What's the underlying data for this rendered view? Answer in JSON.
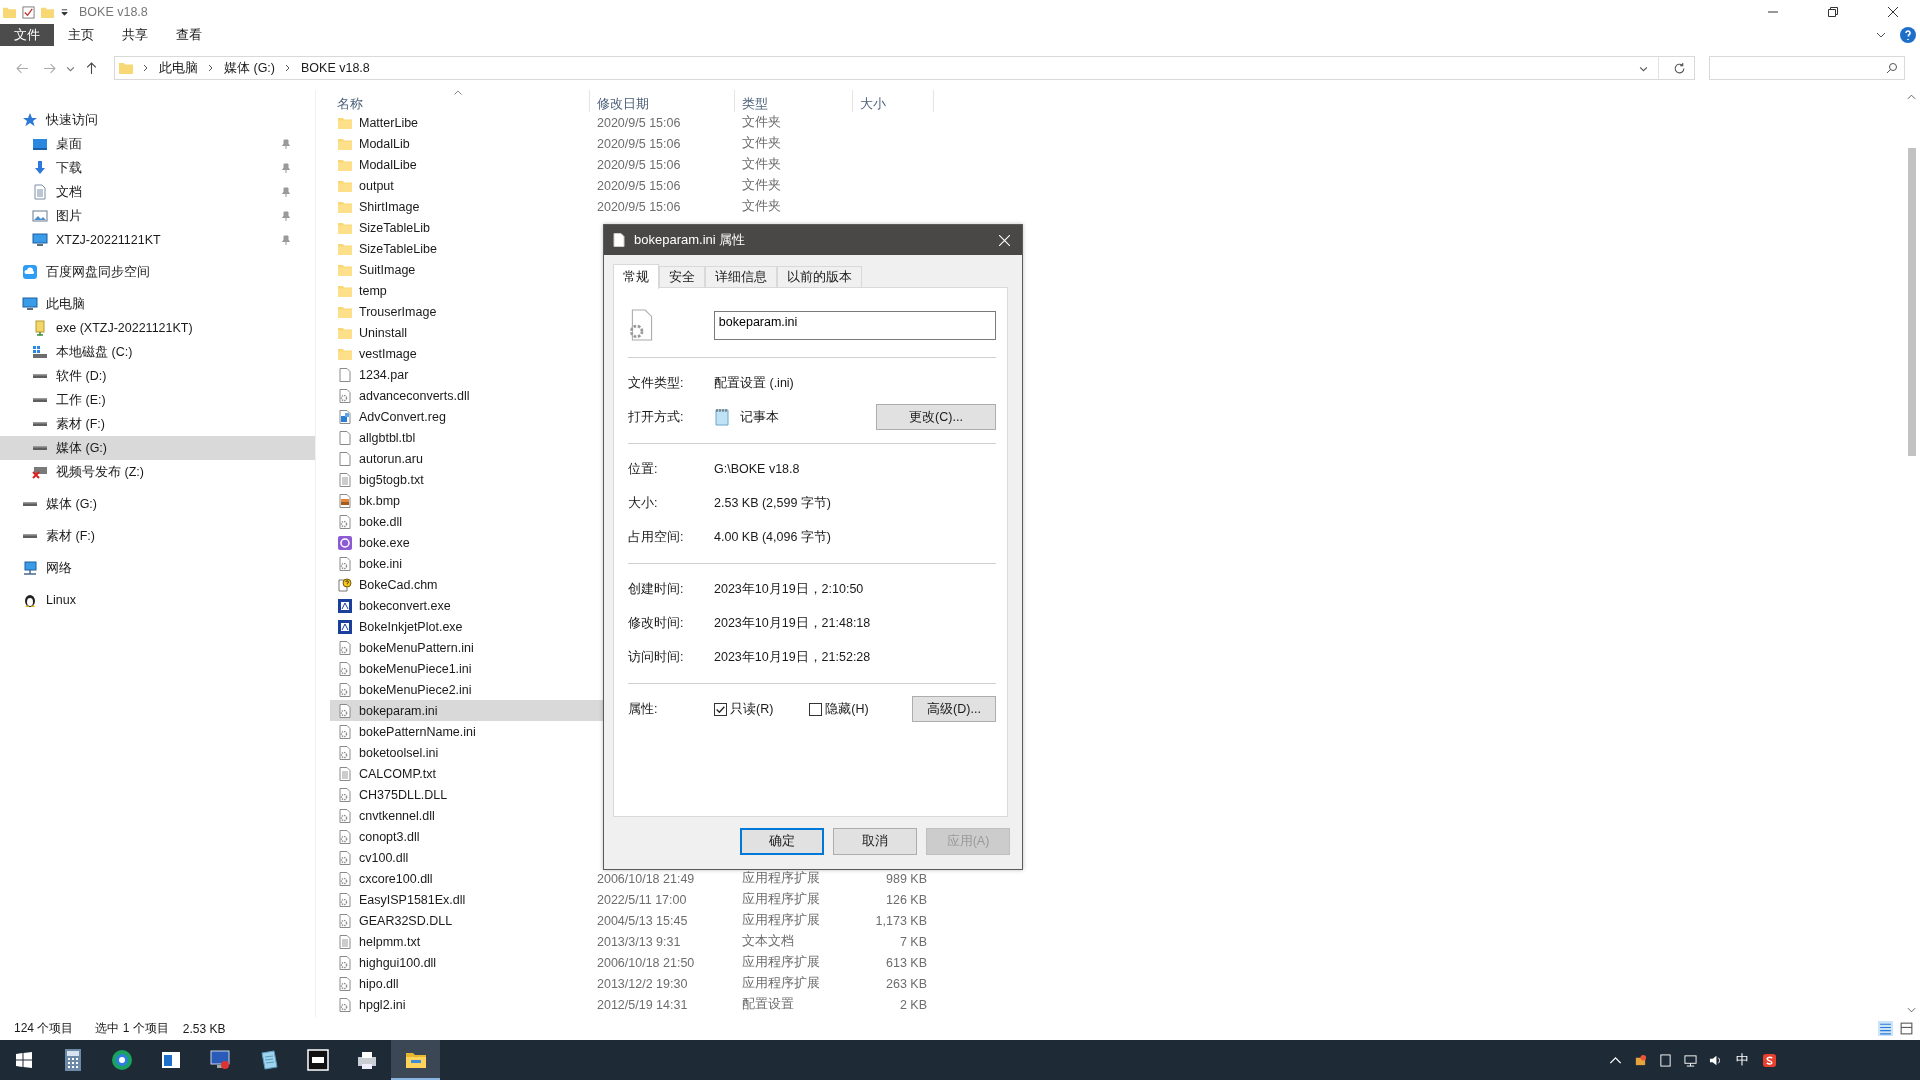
{
  "window": {
    "title": "BOKE v18.8"
  },
  "ribbon_tabs": [
    {
      "label": "文件",
      "selected": true
    },
    {
      "label": "主页",
      "selected": false
    },
    {
      "label": "共享",
      "selected": false
    },
    {
      "label": "查看",
      "selected": false
    }
  ],
  "address_bar": {
    "path": [
      "此电脑",
      "媒体 (G:)",
      "BOKE v18.8"
    ]
  },
  "nav": [
    {
      "label": "快速访问",
      "kind": "star",
      "selected": false,
      "children": [
        {
          "label": "桌面",
          "kind": "desktop",
          "selected": false,
          "pinned": true
        },
        {
          "label": "下载",
          "kind": "download",
          "selected": false,
          "pinned": true
        },
        {
          "label": "文档",
          "kind": "document",
          "selected": false,
          "pinned": true
        },
        {
          "label": "图片",
          "kind": "pictures",
          "selected": false,
          "pinned": true
        },
        {
          "label": "XTZJ-20221121KT",
          "kind": "computer",
          "selected": false,
          "pinned": true
        }
      ]
    },
    {
      "label": "百度网盘同步空间",
      "kind": "cloud",
      "selected": false
    },
    {
      "label": "此电脑",
      "kind": "computer",
      "selected": false,
      "children": [
        {
          "label": "exe (XTZJ-20221121KT)",
          "kind": "usb",
          "selected": false
        },
        {
          "label": "本地磁盘 (C:)",
          "kind": "system",
          "selected": false
        },
        {
          "label": "软件 (D:)",
          "kind": "drive",
          "selected": false
        },
        {
          "label": "工作 (E:)",
          "kind": "drive",
          "selected": false
        },
        {
          "label": "素材 (F:)",
          "kind": "drive",
          "selected": false
        },
        {
          "label": "媒体 (G:)",
          "kind": "drive",
          "selected": true
        },
        {
          "label": "视频号发布 (Z:)",
          "kind": "netdrive",
          "selected": false
        }
      ]
    },
    {
      "label": "媒体 (G:)",
      "kind": "drive",
      "selected": false
    },
    {
      "label": "素材 (F:)",
      "kind": "drive",
      "selected": false
    },
    {
      "label": "网络",
      "kind": "network",
      "selected": false
    },
    {
      "label": "Linux",
      "kind": "penguin",
      "selected": false
    }
  ],
  "columns": [
    "名称",
    "修改日期",
    "类型",
    "大小"
  ],
  "files": [
    {
      "name": "MatterLibe",
      "kind": "folder",
      "date": "2020/9/5 15:06",
      "type": "文件夹",
      "selected": false
    },
    {
      "name": "ModalLib",
      "kind": "folder",
      "date": "2020/9/5 15:06",
      "type": "文件夹",
      "selected": false
    },
    {
      "name": "ModalLibe",
      "kind": "folder",
      "date": "2020/9/5 15:06",
      "type": "文件夹",
      "selected": false
    },
    {
      "name": "output",
      "kind": "folder",
      "date": "2020/9/5 15:06",
      "type": "文件夹",
      "selected": false
    },
    {
      "name": "ShirtImage",
      "kind": "folder",
      "date": "2020/9/5 15:06",
      "type": "文件夹",
      "selected": false
    },
    {
      "name": "SizeTableLib",
      "kind": "folder",
      "selected": false
    },
    {
      "name": "SizeTableLibe",
      "kind": "folder",
      "selected": false
    },
    {
      "name": "SuitImage",
      "kind": "folder",
      "selected": false
    },
    {
      "name": "temp",
      "kind": "folder",
      "selected": false
    },
    {
      "name": "TrouserImage",
      "kind": "folder",
      "selected": false
    },
    {
      "name": "Uninstall",
      "kind": "folder",
      "selected": false
    },
    {
      "name": "vestImage",
      "kind": "folder",
      "selected": false
    },
    {
      "name": "1234.par",
      "kind": "blank",
      "selected": false
    },
    {
      "name": "advanceconverts.dll",
      "kind": "config",
      "selected": false
    },
    {
      "name": "AdvConvert.reg",
      "kind": "reg",
      "selected": false
    },
    {
      "name": "allgbtbl.tbl",
      "kind": "blank",
      "selected": false
    },
    {
      "name": "autorun.aru",
      "kind": "blank",
      "selected": false
    },
    {
      "name": "big5togb.txt",
      "kind": "text",
      "selected": false
    },
    {
      "name": "bk.bmp",
      "kind": "image",
      "selected": false
    },
    {
      "name": "boke.dll",
      "kind": "config",
      "selected": false
    },
    {
      "name": "boke.exe",
      "kind": "exe",
      "selected": false
    },
    {
      "name": "boke.ini",
      "kind": "config",
      "selected": false
    },
    {
      "name": "BokeCad.chm",
      "kind": "help",
      "selected": false
    },
    {
      "name": "bokeconvert.exe",
      "kind": "app",
      "selected": false
    },
    {
      "name": "BokeInkjetPlot.exe",
      "kind": "app",
      "selected": false
    },
    {
      "name": "bokeMenuPattern.ini",
      "kind": "config",
      "selected": false
    },
    {
      "name": "bokeMenuPiece1.ini",
      "kind": "config",
      "selected": false
    },
    {
      "name": "bokeMenuPiece2.ini",
      "kind": "config",
      "selected": false
    },
    {
      "name": "bokeparam.ini",
      "kind": "config",
      "selected": true
    },
    {
      "name": "bokePatternName.ini",
      "kind": "config",
      "selected": false
    },
    {
      "name": "boketoolsel.ini",
      "kind": "config",
      "selected": false
    },
    {
      "name": "CALCOMP.txt",
      "kind": "text",
      "selected": false
    },
    {
      "name": "CH375DLL.DLL",
      "kind": "config",
      "selected": false
    },
    {
      "name": "cnvtkennel.dll",
      "kind": "config",
      "selected": false
    },
    {
      "name": "conopt3.dll",
      "kind": "config",
      "selected": false
    },
    {
      "name": "cv100.dll",
      "kind": "config",
      "selected": false
    },
    {
      "name": "cxcore100.dll",
      "kind": "config",
      "date": "2006/10/18 21:49",
      "type": "应用程序扩展",
      "size": "989 KB",
      "selected": false
    },
    {
      "name": "EasyISP1581Ex.dll",
      "kind": "config",
      "date": "2022/5/11 17:00",
      "type": "应用程序扩展",
      "size": "126 KB",
      "selected": false
    },
    {
      "name": "GEAR32SD.DLL",
      "kind": "config",
      "date": "2004/5/13 15:45",
      "type": "应用程序扩展",
      "size": "1,173 KB",
      "selected": false
    },
    {
      "name": "helpmm.txt",
      "kind": "text",
      "date": "2013/3/13 9:31",
      "type": "文本文档",
      "size": "7 KB",
      "selected": false
    },
    {
      "name": "highgui100.dll",
      "kind": "config",
      "date": "2006/10/18 21:50",
      "type": "应用程序扩展",
      "size": "613 KB",
      "selected": false
    },
    {
      "name": "hipo.dll",
      "kind": "config",
      "date": "2013/12/2 19:30",
      "type": "应用程序扩展",
      "size": "263 KB",
      "selected": false
    },
    {
      "name": "hpgl2.ini",
      "kind": "config",
      "date": "2012/5/19 14:31",
      "type": "配置设置",
      "size": "2 KB",
      "selected": false
    }
  ],
  "status_bar": {
    "item_count": "124 个项目",
    "selection": "选中 1 个项目",
    "selection_size": "2.53 KB"
  },
  "dialog": {
    "title": "bokeparam.ini 属性",
    "tabs": [
      {
        "label": "常规",
        "selected": true
      },
      {
        "label": "安全",
        "selected": false
      },
      {
        "label": "详细信息",
        "selected": false
      },
      {
        "label": "以前的版本",
        "selected": false
      }
    ],
    "filename": "bokeparam.ini",
    "file_type": {
      "label": "文件类型:",
      "value": "配置设置 (.ini)"
    },
    "open_with": {
      "label": "打开方式:",
      "value": "记事本",
      "button": "更改(C)..."
    },
    "location_group": [
      {
        "label": "位置:",
        "value": "G:\\BOKE v18.8"
      },
      {
        "label": "大小:",
        "value": "2.53 KB (2,599 字节)"
      },
      {
        "label": "占用空间:",
        "value": "4.00 KB (4,096 字节)"
      }
    ],
    "time_group": [
      {
        "label": "创建时间:",
        "value": "2023年10月19日，2:10:50"
      },
      {
        "label": "修改时间:",
        "value": "2023年10月19日，21:48:18"
      },
      {
        "label": "访问时间:",
        "value": "2023年10月19日，21:52:28"
      }
    ],
    "attributes": {
      "label": "属性:",
      "options": [
        {
          "label": "只读(R)",
          "checked": true
        },
        {
          "label": "隐藏(H)",
          "checked": false
        }
      ],
      "button": "高级(D)..."
    },
    "buttons": [
      {
        "label": "确定",
        "default": true,
        "disabled": false
      },
      {
        "label": "取消",
        "default": false,
        "disabled": false
      },
      {
        "label": "应用(A)",
        "default": false,
        "disabled": true
      }
    ]
  },
  "taskbar": {
    "apps": [
      {
        "kind": "calculator",
        "active": false
      },
      {
        "kind": "browser",
        "active": false
      },
      {
        "kind": "window",
        "active": false
      },
      {
        "kind": "monitor",
        "active": false
      },
      {
        "kind": "notepad",
        "active": false
      },
      {
        "kind": "ndi",
        "active": false
      },
      {
        "kind": "printer",
        "active": false
      },
      {
        "kind": "folder",
        "active": true
      }
    ],
    "ime": "中"
  }
}
